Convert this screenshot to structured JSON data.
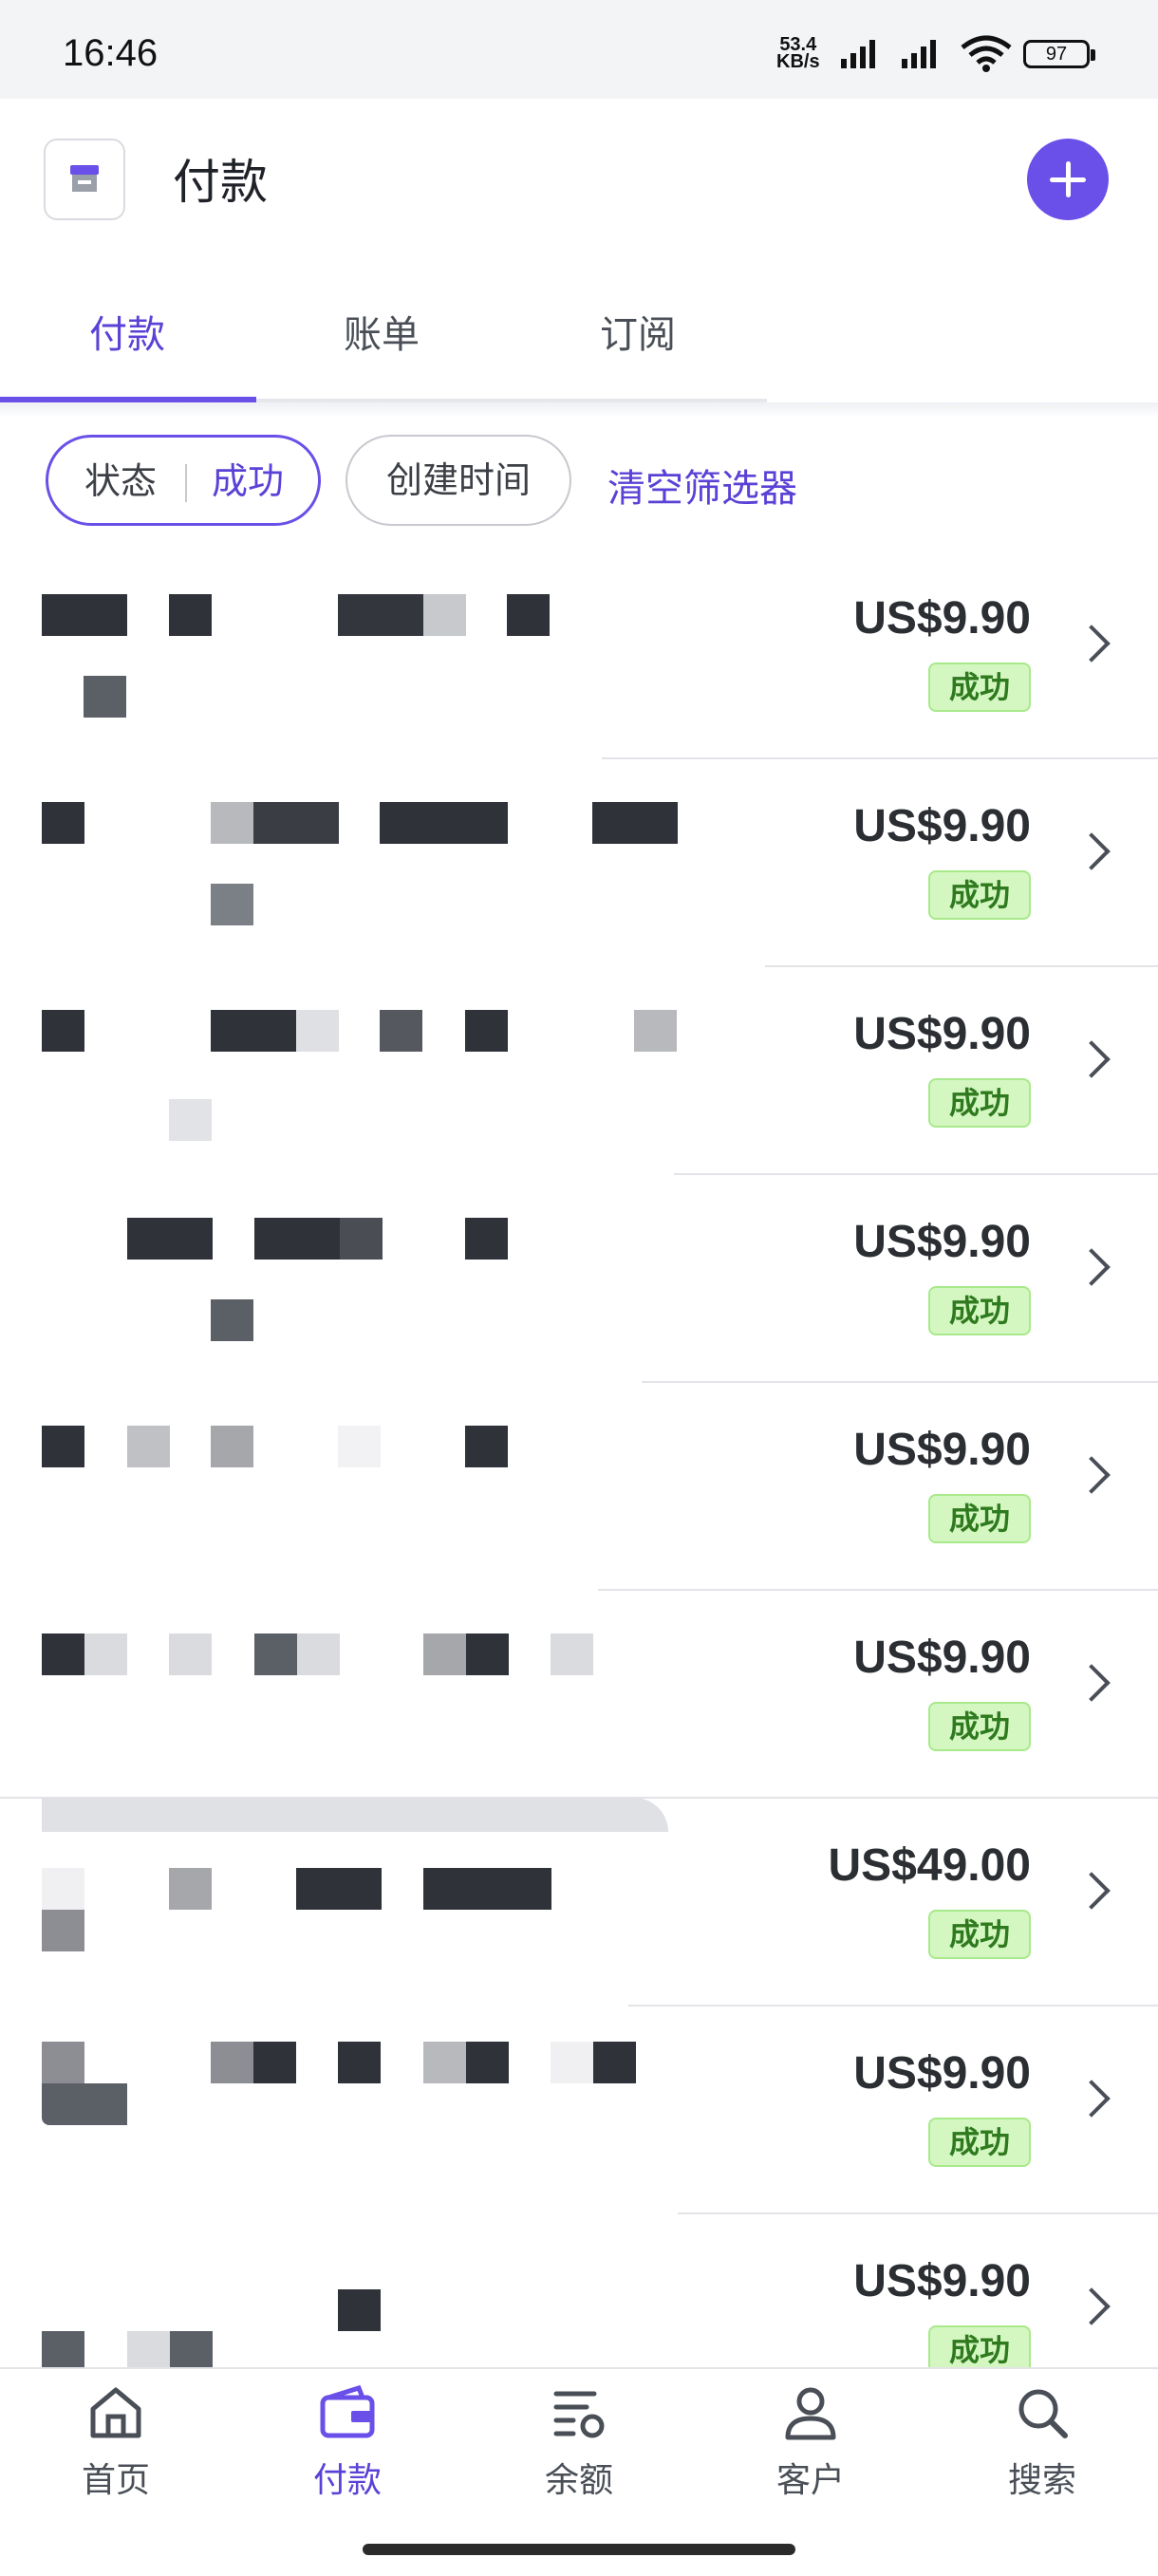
{
  "status_bar": {
    "time": "16:46",
    "net_speed": "53.4",
    "net_unit": "KB/s",
    "battery": "97"
  },
  "header": {
    "title": "付款",
    "store_icon": "store-icon",
    "add_icon": "plus-icon"
  },
  "tabs": [
    {
      "label": "付款",
      "active": true
    },
    {
      "label": "账单",
      "active": false
    },
    {
      "label": "订阅",
      "active": false
    }
  ],
  "filters": {
    "status_key": "状态",
    "status_value": "成功",
    "created": "创建时间",
    "clear": "清空筛选器"
  },
  "payments": [
    {
      "amount": "US$9.90",
      "status": "成功"
    },
    {
      "amount": "US$9.90",
      "status": "成功"
    },
    {
      "amount": "US$9.90",
      "status": "成功"
    },
    {
      "amount": "US$9.90",
      "status": "成功"
    },
    {
      "amount": "US$9.90",
      "status": "成功"
    },
    {
      "amount": "US$9.90",
      "status": "成功"
    },
    {
      "amount": "US$49.00",
      "status": "成功"
    },
    {
      "amount": "US$9.90",
      "status": "成功"
    },
    {
      "amount": "US$9.90",
      "status": "成功"
    }
  ],
  "bottom_nav": [
    {
      "label": "首页",
      "icon": "home-icon",
      "active": false
    },
    {
      "label": "付款",
      "icon": "wallet-icon",
      "active": true
    },
    {
      "label": "余额",
      "icon": "balance-icon",
      "active": false
    },
    {
      "label": "客户",
      "icon": "user-icon",
      "active": false
    },
    {
      "label": "搜索",
      "icon": "search-icon",
      "active": false
    }
  ],
  "colors": {
    "accent": "#6a4fe8",
    "success_bg": "#d4f7c2",
    "success_text": "#2f7a1e"
  }
}
